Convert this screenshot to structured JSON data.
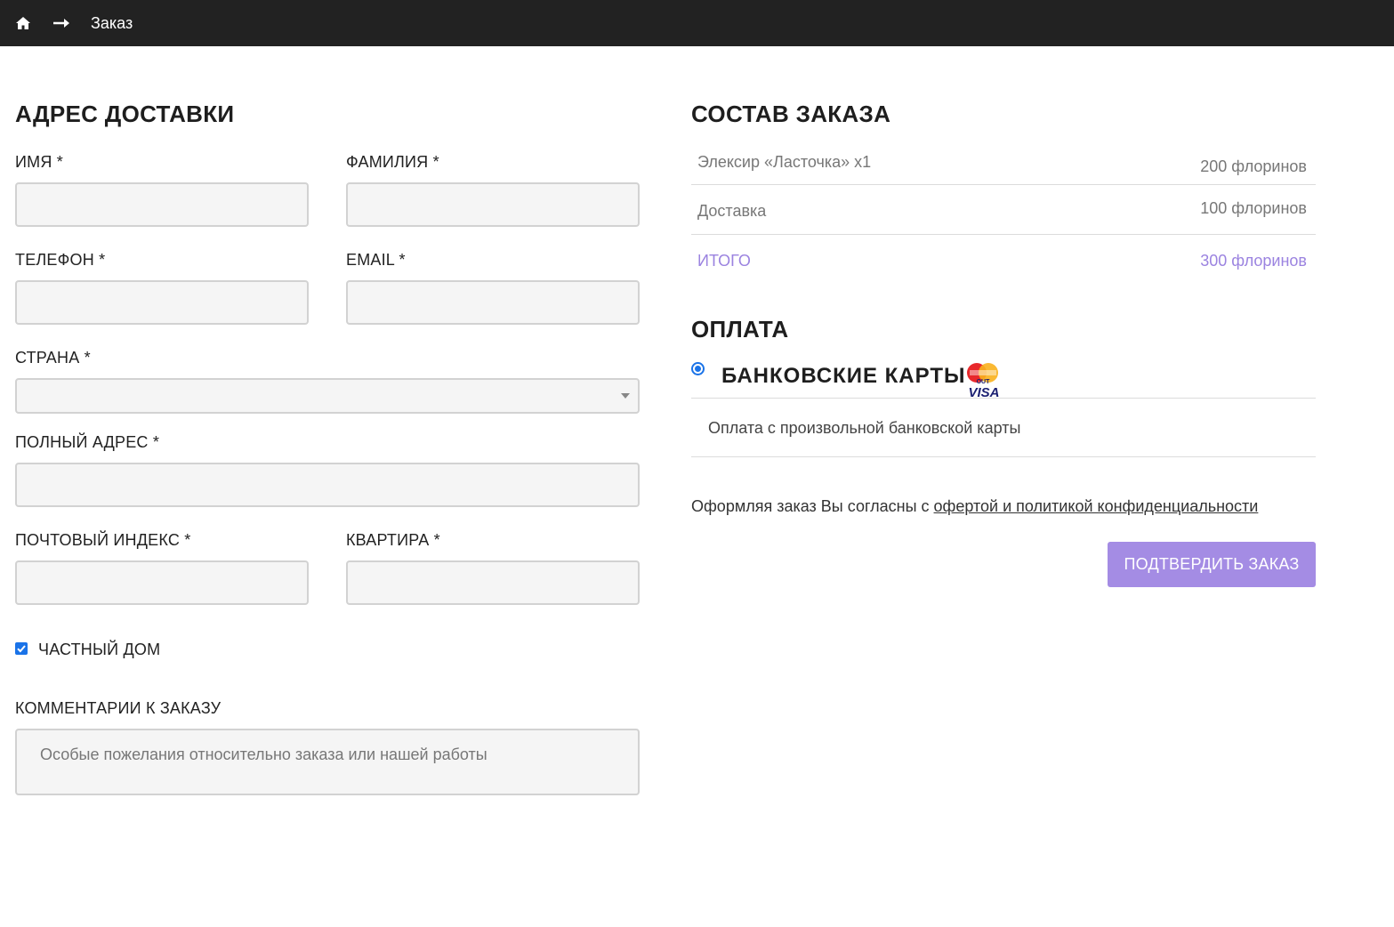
{
  "topbar": {
    "home_icon": "home-icon",
    "arrow_icon": "arrow-right-icon",
    "breadcrumb": "Заказ"
  },
  "shipping": {
    "title": "АДРЕС ДОСТАВКИ",
    "first_name_label": "ИМЯ *",
    "first_name_value": "",
    "last_name_label": "ФАМИЛИЯ *",
    "last_name_value": "",
    "phone_label": "ТЕЛЕФОН *",
    "phone_value": "",
    "email_label": "EMAIL *",
    "email_value": "",
    "country_label": "СТРАНА *",
    "country_value": "",
    "address_label": "ПОЛНЫЙ АДРЕС *",
    "address_value": "",
    "zip_label": "ПОЧТОВЫЙ ИНДЕКС *",
    "zip_value": "",
    "apartment_label": "КВАРТИРА *",
    "apartment_value": "",
    "private_house_label": "ЧАСТНЫЙ ДОМ",
    "private_house_checked": true,
    "comments_label": "КОММЕНТАРИИ К ЗАКАЗУ",
    "comments_placeholder": "Особые пожелания относительно заказа или нашей работы"
  },
  "order": {
    "title": "СОСТАВ ЗАКАЗА",
    "items": [
      {
        "name": "Элексир «Ласточка» x1",
        "price": "200 флоринов"
      },
      {
        "name": "Доставка",
        "price": "100 флоринов"
      }
    ],
    "total": {
      "name": "ИТОГО",
      "price": "300 флоринов"
    }
  },
  "payment": {
    "title": "ОПЛАТА",
    "method_label": "БАНКОВСКИЕ КАРТЫ",
    "method_selected": true,
    "cards_icon": "mastercard-visa-icon",
    "description": "Оплата с произвольной банковской карты",
    "agreement_text": "Оформляя заказ Вы согласны с ",
    "agreement_link": "офертой и политикой конфиденциальности",
    "confirm_button": "ПОДТВЕРДИТЬ ЗАКАЗ"
  },
  "colors": {
    "topbar_bg": "#222222",
    "accent": "#a48ce4",
    "total_text": "#9b83e0",
    "input_bg": "#f5f5f5",
    "checkbox": "#1a73e8"
  }
}
